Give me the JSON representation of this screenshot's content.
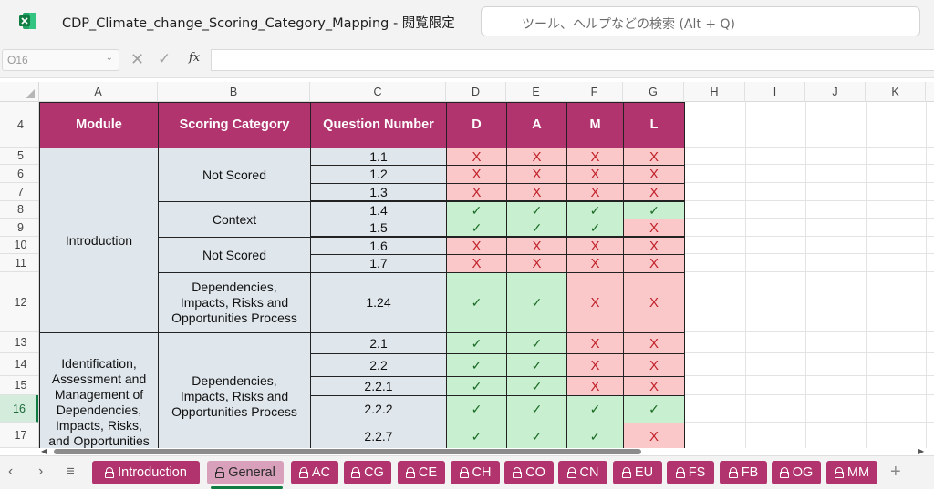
{
  "app": {
    "title": "CDP_Climate_change_Scoring_Category_Mapping  -  閲覧限定",
    "search_placeholder": "ツール、ヘルプなどの検索 (Alt + Q)",
    "logo_icon": "excel-icon",
    "accent": "#107c41"
  },
  "formula_bar": {
    "name_box": "O16",
    "fx_label": "fx",
    "formula": ""
  },
  "columns": [
    "A",
    "B",
    "C",
    "D",
    "E",
    "F",
    "G",
    "H",
    "I",
    "J",
    "K"
  ],
  "rows": [
    "4",
    "5",
    "6",
    "7",
    "8",
    "9",
    "10",
    "11",
    "12",
    "13",
    "14",
    "15",
    "16",
    "17"
  ],
  "selected_row": "16",
  "table": {
    "header_color": "#b1346e",
    "ok_color": "#c8efcf",
    "no_color": "#fbc8ca",
    "headers": [
      "Module",
      "Scoring Category",
      "Question Number",
      "D",
      "A",
      "M",
      "L"
    ],
    "modules": [
      "Introduction",
      "Identification, Assessment and Management of Dependencies, Impacts, Risks, and Opportunities"
    ],
    "categories": [
      "Not Scored",
      "Context",
      "Not Scored",
      "Dependencies, Impacts, Risks and Opportunities Process",
      "Dependencies, Impacts, Risks and Opportunities Process"
    ],
    "rows": [
      {
        "q": "1.1",
        "d": "X",
        "a": "X",
        "m": "X",
        "l": "X"
      },
      {
        "q": "1.2",
        "d": "X",
        "a": "X",
        "m": "X",
        "l": "X"
      },
      {
        "q": "1.3",
        "d": "X",
        "a": "X",
        "m": "X",
        "l": "X"
      },
      {
        "q": "1.4",
        "d": "✓",
        "a": "✓",
        "m": "✓",
        "l": "✓"
      },
      {
        "q": "1.5",
        "d": "✓",
        "a": "✓",
        "m": "✓",
        "l": "X"
      },
      {
        "q": "1.6",
        "d": "X",
        "a": "X",
        "m": "X",
        "l": "X"
      },
      {
        "q": "1.7",
        "d": "X",
        "a": "X",
        "m": "X",
        "l": "X"
      },
      {
        "q": "1.24",
        "d": "✓",
        "a": "✓",
        "m": "X",
        "l": "X"
      },
      {
        "q": "2.1",
        "d": "✓",
        "a": "✓",
        "m": "X",
        "l": "X"
      },
      {
        "q": "2.2",
        "d": "✓",
        "a": "✓",
        "m": "X",
        "l": "X"
      },
      {
        "q": "2.2.1",
        "d": "✓",
        "a": "✓",
        "m": "X",
        "l": "X"
      },
      {
        "q": "2.2.2",
        "d": "✓",
        "a": "✓",
        "m": "✓",
        "l": "✓"
      },
      {
        "q": "2.2.7",
        "d": "✓",
        "a": "✓",
        "m": "✓",
        "l": "X"
      }
    ]
  },
  "sheet_tabs": [
    "Introduction",
    "General",
    "AC",
    "CG",
    "CE",
    "CH",
    "CO",
    "CN",
    "EU",
    "FS",
    "FB",
    "OG",
    "MM"
  ],
  "active_tab": "General",
  "tab_icons": {
    "lock": "lock-icon",
    "add": "plus-icon",
    "prev": "chevron-left-icon",
    "next": "chevron-right-icon",
    "menu": "hamburger-icon"
  }
}
